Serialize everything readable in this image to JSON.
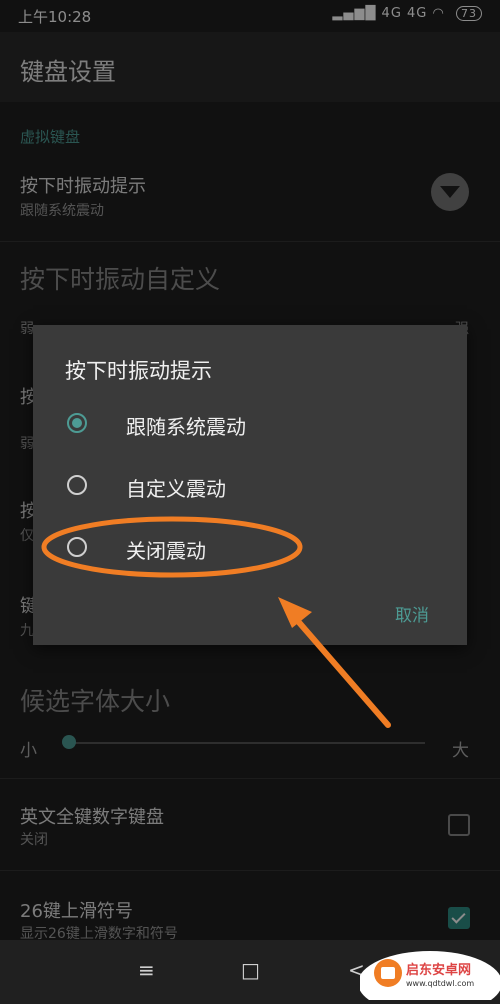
{
  "status_bar": {
    "time": "上午10:28",
    "network": "4G 4G",
    "battery": "73"
  },
  "app_bar": {
    "title": "键盘设置"
  },
  "settings": {
    "section_virtual": "虚拟键盘",
    "vibration_title": "按下时振动提示",
    "vibration_sub": "跟随系统震动",
    "custom_vibration_title": "按下时振动自定义",
    "slider_weak": "弱",
    "slider_strong": "强",
    "font_size_title": "候选字体大小",
    "font_small": "小",
    "font_large": "大",
    "eng_numeric_title": "英文全键数字键盘",
    "eng_numeric_sub": "关闭",
    "swipe_symbol_title": "26键上滑符号",
    "swipe_symbol_sub": "显示26键上滑数字和符号",
    "partial_press": "按",
    "partial_weak": "弱",
    "partial_press2": "按",
    "partial_only": "仅",
    "partial_key": "键",
    "partial_nine": "九"
  },
  "dialog": {
    "title": "按下时振动提示",
    "options": [
      {
        "label": "跟随系统震动",
        "selected": true
      },
      {
        "label": "自定义震动",
        "selected": false
      },
      {
        "label": "关闭震动",
        "selected": false
      }
    ],
    "cancel": "取消"
  },
  "nav_bar": {
    "menu_icon": "≡",
    "home_icon": "□",
    "back_icon": "<"
  },
  "watermark": {
    "text": "启东安卓网",
    "url_text": "www.qdtdwl.com"
  },
  "colors": {
    "accent": "#4d9b94",
    "annotation": "#f07d24"
  }
}
